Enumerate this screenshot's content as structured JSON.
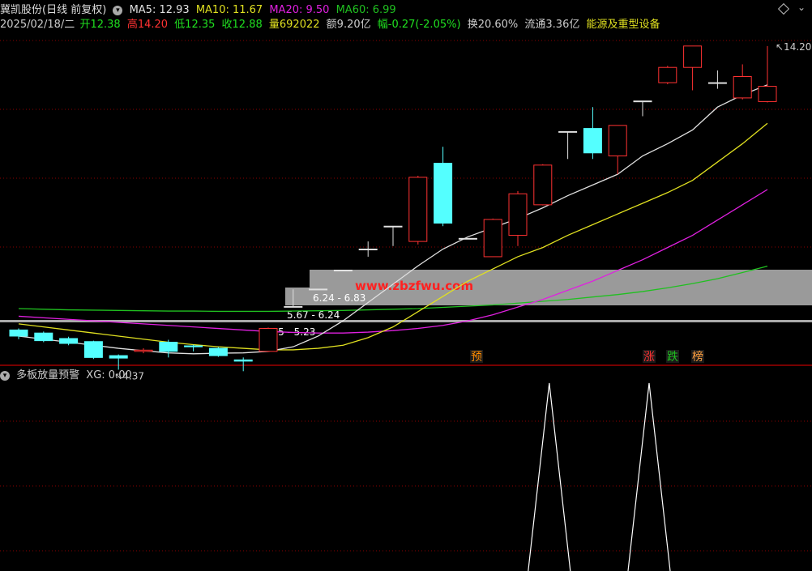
{
  "header": {
    "title": "冀凯股份(日线 前复权)",
    "ma5": "MA5: 12.93",
    "ma10": "MA10: 11.67",
    "ma20": "MA20: 9.50",
    "ma60": "MA60: 6.99",
    "date": "2025/02/18/二",
    "open": "开12.38",
    "high": "高14.20",
    "low": "低12.35",
    "close": "收12.88",
    "volume": "量692022",
    "amount": "额9.20亿",
    "change": "幅-0.27(-2.05%)",
    "turnover": "换20.60%",
    "float": "流通3.36亿",
    "sector": "能源及重型设备"
  },
  "colors": {
    "up": "#ff3232",
    "down": "#54ffff",
    "ma5": "#e0e0e0",
    "ma10": "#e0e020",
    "ma20": "#e020e0",
    "ma60": "#20c020",
    "grid": "#8b0000",
    "text": "#cccccc"
  },
  "main_chart": {
    "candles": [
      {
        "o": 4.9,
        "c": 4.7,
        "h": 4.95,
        "l": 4.6
      },
      {
        "o": 4.8,
        "c": 4.55,
        "h": 4.85,
        "l": 4.5
      },
      {
        "o": 4.62,
        "c": 4.46,
        "h": 4.68,
        "l": 4.4
      },
      {
        "o": 4.52,
        "c": 4.0,
        "h": 4.55,
        "l": 3.95
      },
      {
        "o": 4.06,
        "c": 3.98,
        "h": 4.1,
        "l": 3.6
      },
      {
        "o": 4.2,
        "c": 4.24,
        "h": 4.3,
        "l": 4.14
      },
      {
        "o": 4.5,
        "c": 4.2,
        "h": 4.58,
        "l": 4.0
      },
      {
        "o": 4.38,
        "c": 4.35,
        "h": 4.42,
        "l": 4.2
      },
      {
        "o": 4.3,
        "c": 4.06,
        "h": 4.34,
        "l": 4.02
      },
      {
        "o": 3.92,
        "c": 3.88,
        "h": 4.0,
        "l": 3.55
      },
      {
        "o": 4.2,
        "c": 4.95,
        "h": 4.98,
        "l": 4.18
      },
      {
        "o": 5.67,
        "c": 5.67,
        "h": 6.23,
        "l": 5.67
      },
      {
        "o": 6.24,
        "c": 6.24,
        "h": 6.24,
        "l": 6.24
      },
      {
        "o": 6.86,
        "c": 6.86,
        "h": 6.86,
        "l": 6.86
      },
      {
        "o": 7.55,
        "c": 7.55,
        "h": 7.8,
        "l": 7.3
      },
      {
        "o": 8.3,
        "c": 8.3,
        "h": 8.3,
        "l": 7.65
      },
      {
        "o": 7.8,
        "c": 9.9,
        "h": 9.95,
        "l": 7.7
      },
      {
        "o": 10.36,
        "c": 8.4,
        "h": 10.9,
        "l": 8.3
      },
      {
        "o": 7.9,
        "c": 7.9,
        "h": 7.9,
        "l": 7.9
      },
      {
        "o": 7.3,
        "c": 8.52,
        "h": 8.55,
        "l": 7.3
      },
      {
        "o": 8.0,
        "c": 9.36,
        "h": 9.45,
        "l": 7.65
      },
      {
        "o": 9.0,
        "c": 10.3,
        "h": 10.33,
        "l": 8.98
      },
      {
        "o": 11.4,
        "c": 11.4,
        "h": 11.4,
        "l": 10.5
      },
      {
        "o": 11.5,
        "c": 10.7,
        "h": 12.2,
        "l": 10.5
      },
      {
        "o": 10.6,
        "c": 11.6,
        "h": 11.6,
        "l": 10.0
      },
      {
        "o": 12.4,
        "c": 12.4,
        "h": 12.4,
        "l": 11.9
      },
      {
        "o": 13.0,
        "c": 13.5,
        "h": 13.55,
        "l": 12.95
      },
      {
        "o": 13.5,
        "c": 14.2,
        "h": 14.2,
        "l": 12.75
      },
      {
        "o": 13.0,
        "c": 13.0,
        "h": 13.4,
        "l": 12.8
      },
      {
        "o": 12.5,
        "c": 13.2,
        "h": 13.6,
        "l": 12.45
      },
      {
        "o": 12.38,
        "c": 12.88,
        "h": 14.2,
        "l": 12.35
      }
    ],
    "ma5": [
      4.7,
      4.6,
      4.5,
      4.4,
      4.3,
      4.22,
      4.15,
      4.12,
      4.14,
      4.15,
      4.2,
      4.35,
      4.7,
      5.2,
      5.8,
      6.4,
      7.0,
      7.55,
      7.95,
      8.25,
      8.55,
      8.9,
      9.3,
      9.65,
      10.0,
      10.6,
      11.0,
      11.45,
      12.2,
      12.6,
      12.93
    ],
    "ma10": [
      5.1,
      5.0,
      4.9,
      4.8,
      4.7,
      4.6,
      4.5,
      4.42,
      4.35,
      4.3,
      4.25,
      4.25,
      4.3,
      4.4,
      4.65,
      5.0,
      5.5,
      6.0,
      6.5,
      6.9,
      7.3,
      7.6,
      8.0,
      8.35,
      8.7,
      9.05,
      9.4,
      9.8,
      10.4,
      11.0,
      11.67
    ],
    "ma20": [
      5.35,
      5.3,
      5.25,
      5.2,
      5.15,
      5.1,
      5.05,
      5.0,
      4.95,
      4.9,
      4.85,
      4.82,
      4.8,
      4.8,
      4.83,
      4.88,
      4.95,
      5.05,
      5.2,
      5.4,
      5.65,
      5.9,
      6.2,
      6.5,
      6.85,
      7.2,
      7.6,
      8.0,
      8.5,
      9.0,
      9.5
    ],
    "ma60": [
      5.6,
      5.58,
      5.56,
      5.55,
      5.54,
      5.53,
      5.52,
      5.52,
      5.51,
      5.51,
      5.51,
      5.52,
      5.53,
      5.54,
      5.56,
      5.58,
      5.6,
      5.64,
      5.68,
      5.72,
      5.78,
      5.84,
      5.9,
      5.98,
      6.06,
      6.16,
      6.28,
      6.42,
      6.58,
      6.78,
      6.99
    ],
    "zones": [
      {
        "label": "6.24 - 6.83"
      },
      {
        "label": "5.67 - 6.24"
      },
      {
        "label": "5.15 - 5.23"
      }
    ],
    "high_marker": "14.20",
    "low_marker": "4.37",
    "watermark": "www.zbzfwu.com",
    "tags": [
      {
        "text": "预",
        "color": "#ff8c00"
      },
      {
        "text": "涨",
        "color": "#ff3232"
      },
      {
        "text": "跌",
        "color": "#20c020"
      },
      {
        "text": "榜",
        "color": "#ffa040"
      }
    ]
  },
  "sub_chart": {
    "indicator_name": "多板放量预警",
    "value": "XG: 0.00",
    "signals": [
      21,
      25
    ]
  }
}
